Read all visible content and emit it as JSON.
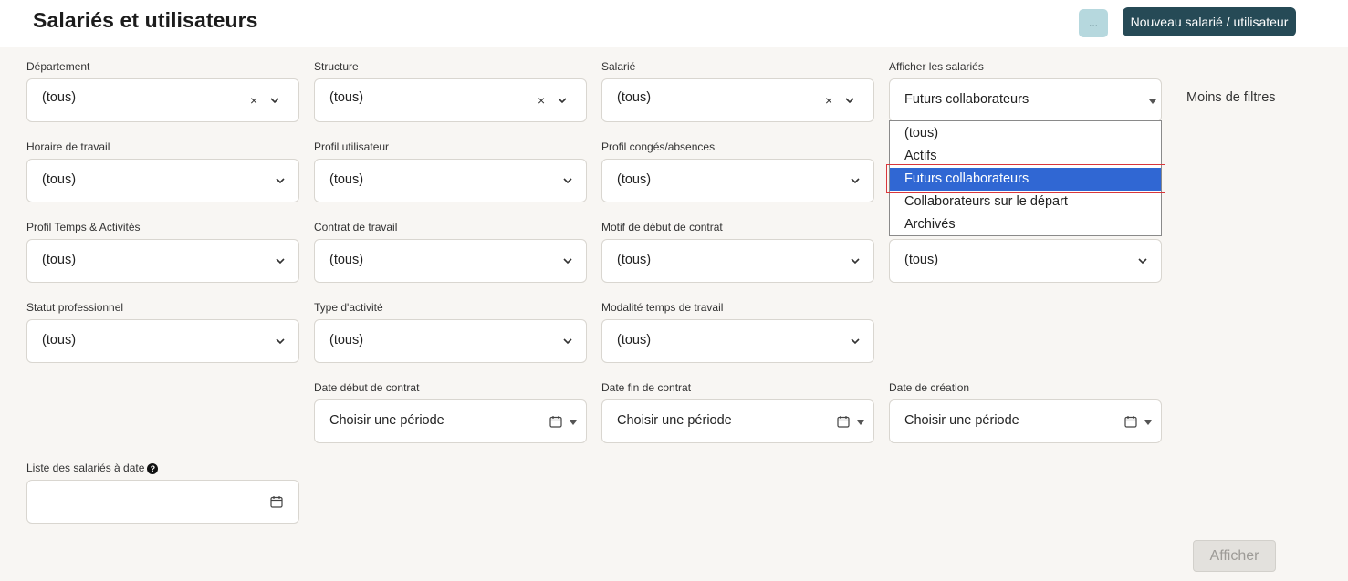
{
  "header": {
    "title": "Salariés et utilisateurs",
    "more_label": "...",
    "new_button_label": "Nouveau salarié / utilisateur"
  },
  "filters": {
    "departement": {
      "label": "Département",
      "value": "(tous)"
    },
    "structure": {
      "label": "Structure",
      "value": "(tous)"
    },
    "salarie": {
      "label": "Salarié",
      "value": "(tous)"
    },
    "afficher_salaries": {
      "label": "Afficher les salariés",
      "value": "Futurs collaborateurs"
    },
    "horaire": {
      "label": "Horaire de travail",
      "value": "(tous)"
    },
    "profil_utilisateur": {
      "label": "Profil utilisateur",
      "value": "(tous)"
    },
    "profil_conges": {
      "label": "Profil congés/absences",
      "value": "(tous)"
    },
    "profil_temps": {
      "label": "Profil Temps & Activités",
      "value": "(tous)"
    },
    "contrat": {
      "label": "Contrat de travail",
      "value": "(tous)"
    },
    "motif_debut": {
      "label": "Motif de début de contrat",
      "value": "(tous)"
    },
    "hidden_col4_row3": {
      "value": "(tous)"
    },
    "statut": {
      "label": "Statut professionnel",
      "value": "(tous)"
    },
    "type_activite": {
      "label": "Type d'activité",
      "value": "(tous)"
    },
    "modalite": {
      "label": "Modalité temps de travail",
      "value": "(tous)"
    },
    "date_debut": {
      "label": "Date début de contrat",
      "placeholder": "Choisir une période"
    },
    "date_fin": {
      "label": "Date fin de contrat",
      "placeholder": "Choisir une période"
    },
    "date_creation": {
      "label": "Date de création",
      "placeholder": "Choisir une période"
    },
    "liste_a_date": {
      "label": "Liste des salariés à date",
      "value": ""
    }
  },
  "less_filters_label": "Moins de filtres",
  "dropdown": {
    "options": [
      "(tous)",
      "Actifs",
      "Futurs collaborateurs",
      "Collaborateurs sur le départ",
      "Archivés"
    ],
    "selected_index": 2
  },
  "afficher_button_label": "Afficher",
  "colors": {
    "primary_dark": "#264a56",
    "light_teal": "#b6d8de",
    "selected_option": "#3067d3",
    "highlight": "#d9363b"
  }
}
